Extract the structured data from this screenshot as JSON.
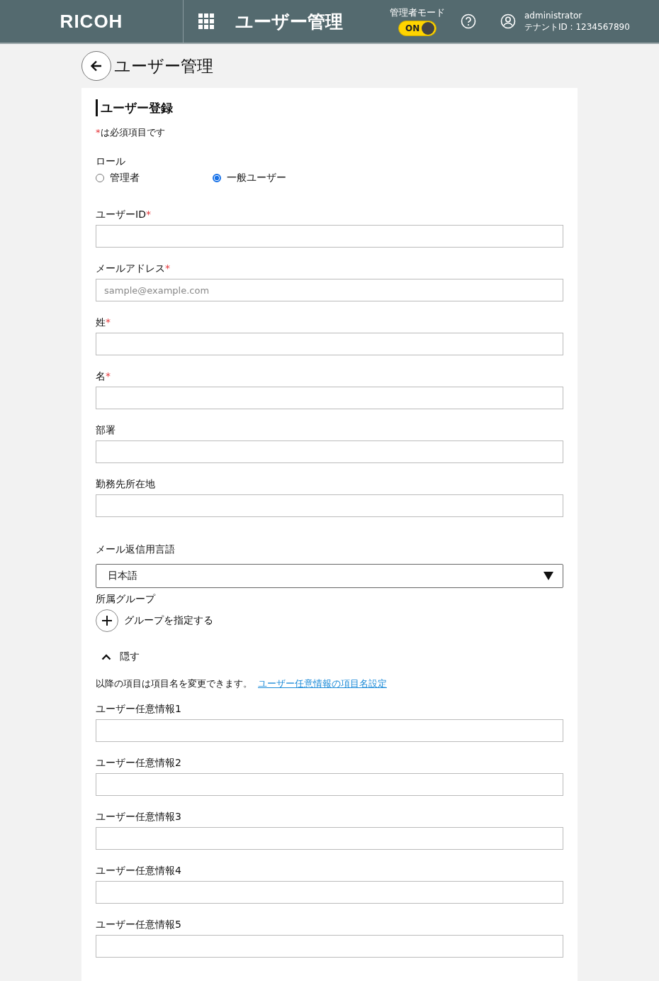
{
  "header": {
    "logo": "RICOH",
    "title": "ユーザー管理",
    "admin_mode": {
      "label": "管理者モード",
      "toggle_label": "ON",
      "on": true
    },
    "user": {
      "name": "administrator",
      "tenant": "テナントID : 1234567890"
    }
  },
  "page": {
    "title": "ユーザー管理"
  },
  "form": {
    "title": "ユーザー登録",
    "required_mark": "*",
    "required_note": "は必須項目です",
    "role": {
      "label": "ロール",
      "options": [
        {
          "label": "管理者",
          "selected": false
        },
        {
          "label": "一般ユーザー",
          "selected": true
        }
      ]
    },
    "fields": [
      {
        "label": "ユーザーID",
        "required": true
      },
      {
        "label": "メールアドレス",
        "required": true,
        "placeholder": "sample@example.com"
      },
      {
        "label": "姓",
        "required": true
      },
      {
        "label": "名",
        "required": true
      },
      {
        "label": "部署",
        "required": false
      },
      {
        "label": "勤務先所在地",
        "required": false
      }
    ],
    "language": {
      "label": "メール返信用言語",
      "value": "日本語"
    },
    "group": {
      "label": "所属グループ",
      "add_label": "グループを指定する"
    },
    "collapse": {
      "label": "隠す",
      "expanded": true
    },
    "custom_note": {
      "text": "以降の項目は項目名を変更できます。",
      "link": "ユーザー任意情報の項目名設定"
    },
    "custom_fields": [
      {
        "label": "ユーザー任意情報1"
      },
      {
        "label": "ユーザー任意情報2"
      },
      {
        "label": "ユーザー任意情報3"
      },
      {
        "label": "ユーザー任意情報4"
      },
      {
        "label": "ユーザー任意情報5"
      }
    ]
  }
}
